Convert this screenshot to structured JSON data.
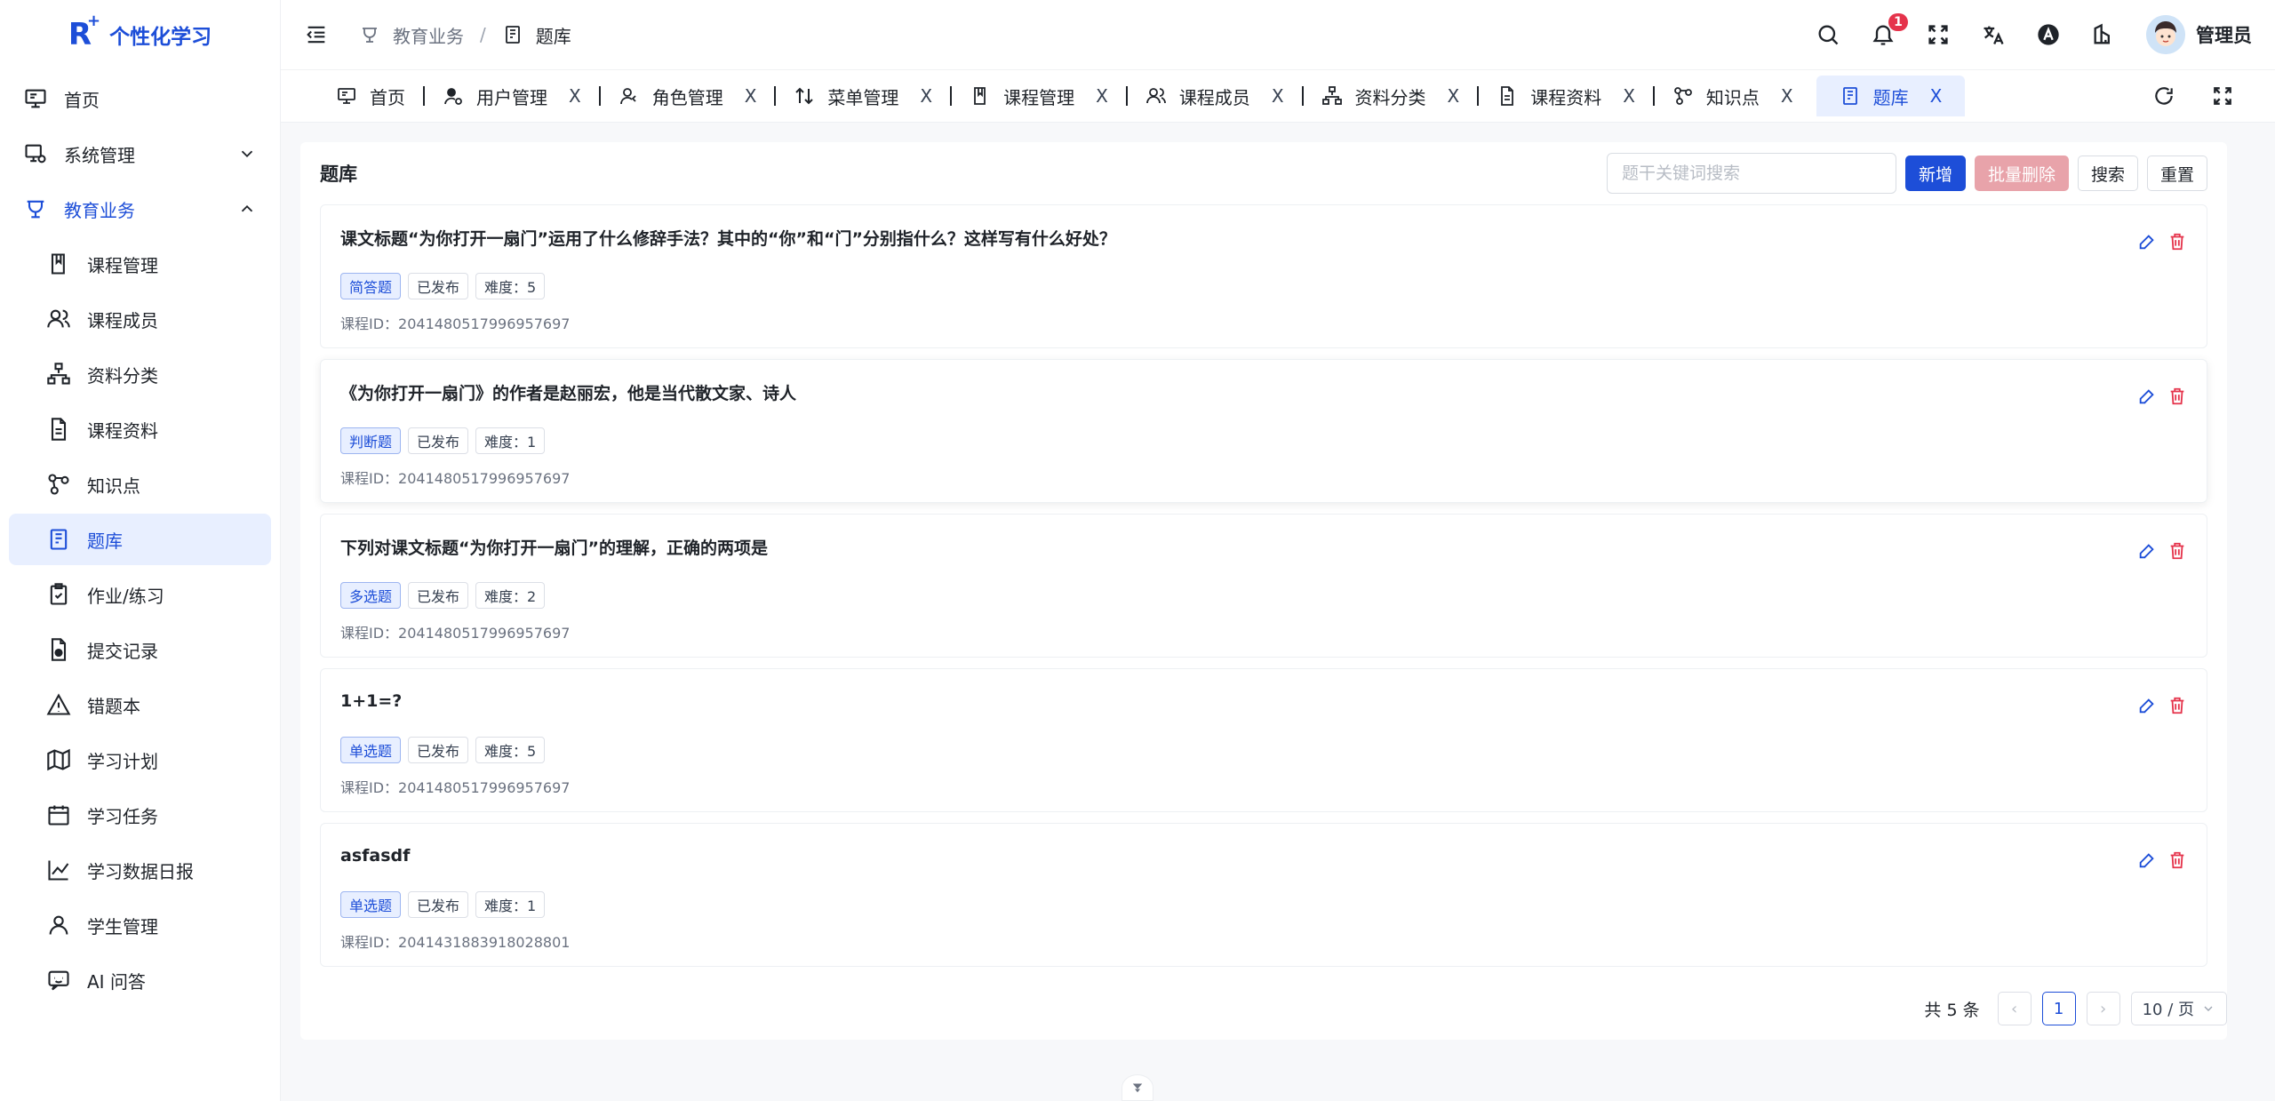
{
  "brand": {
    "logo": "R",
    "logo_sup": "+",
    "name": "个性化学习"
  },
  "sidebar": {
    "items": [
      {
        "label": "首页"
      },
      {
        "label": "系统管理"
      },
      {
        "label": "教育业务"
      }
    ],
    "sub_items": [
      {
        "label": "课程管理"
      },
      {
        "label": "课程成员"
      },
      {
        "label": "资料分类"
      },
      {
        "label": "课程资料"
      },
      {
        "label": "知识点"
      },
      {
        "label": "题库"
      },
      {
        "label": "作业/练习"
      },
      {
        "label": "提交记录"
      },
      {
        "label": "错题本"
      },
      {
        "label": "学习计划"
      },
      {
        "label": "学习任务"
      },
      {
        "label": "学习数据日报"
      },
      {
        "label": "学生管理"
      },
      {
        "label": "AI 问答"
      }
    ]
  },
  "header": {
    "breadcrumb": [
      "教育业务",
      "/",
      "题库"
    ],
    "notification_count": "1",
    "user_name": "管理员"
  },
  "tabs": [
    {
      "label": "首页",
      "close": ""
    },
    {
      "label": "用户管理",
      "close": "X"
    },
    {
      "label": "角色管理",
      "close": "X"
    },
    {
      "label": "菜单管理",
      "close": "X"
    },
    {
      "label": "课程管理",
      "close": "X"
    },
    {
      "label": "课程成员",
      "close": "X"
    },
    {
      "label": "资料分类",
      "close": "X"
    },
    {
      "label": "课程资料",
      "close": "X"
    },
    {
      "label": "知识点",
      "close": "X"
    },
    {
      "label": "题库",
      "close": "X"
    }
  ],
  "panel": {
    "title": "题库",
    "search_placeholder": "题干关键词搜索",
    "add_label": "新增",
    "batch_delete_label": "批量删除",
    "search_label": "搜索",
    "reset_label": "重置"
  },
  "questions": [
    {
      "title": "课文标题“为你打开一扇门”运用了什么修辞手法？其中的“你”和“门”分别指什么？这样写有什么好处？",
      "type": "简答题",
      "status": "已发布",
      "difficulty": "难度：5",
      "course_id": "课程ID：2041480517996957697"
    },
    {
      "title": "《为你打开一扇门》的作者是赵丽宏，他是当代散文家、诗人",
      "type": "判断题",
      "status": "已发布",
      "difficulty": "难度：1",
      "course_id": "课程ID：2041480517996957697"
    },
    {
      "title": "下列对课文标题“为你打开一扇门”的理解，正确的两项是",
      "type": "多选题",
      "status": "已发布",
      "difficulty": "难度：2",
      "course_id": "课程ID：2041480517996957697"
    },
    {
      "title": "1+1=?",
      "type": "单选题",
      "status": "已发布",
      "difficulty": "难度：5",
      "course_id": "课程ID：2041480517996957697"
    },
    {
      "title": "asfasdf",
      "type": "单选题",
      "status": "已发布",
      "difficulty": "难度：1",
      "course_id": "课程ID：2041431883918028801"
    }
  ],
  "pagination": {
    "total": "共 5 条",
    "prev": "‹",
    "current": "1",
    "next": "›",
    "page_size": "10 / 页"
  },
  "colors": {
    "primary": "#1d4ed8",
    "danger": "#e5334b",
    "active_bg": "#e8efff"
  }
}
